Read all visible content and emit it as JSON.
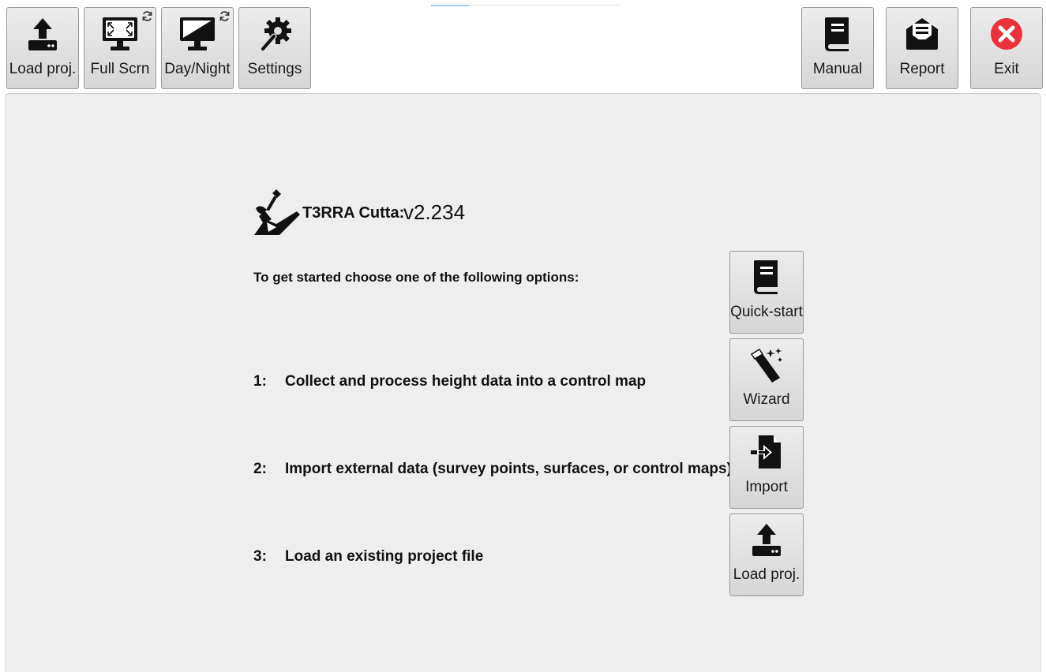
{
  "toolbar": {
    "load_project_label": "Load proj.",
    "full_screen_label": "Full Scrn",
    "day_night_label": "Day/Night",
    "settings_label": "Settings",
    "manual_label": "Manual",
    "report_label": "Report",
    "exit_label": "Exit"
  },
  "app": {
    "name": "T3RRA Cutta:",
    "version": "v2.234"
  },
  "start": {
    "intro": "To get started choose one of the following options:",
    "quickstart_label": "Quick-start",
    "options": [
      {
        "number": "1:",
        "text": "Collect and process height data into a control map",
        "button_label": "Wizard"
      },
      {
        "number": "2:",
        "text": "Import external data (survey points, surfaces, or control maps)",
        "button_label": "Import"
      },
      {
        "number": "3:",
        "text": "Load an existing project file",
        "button_label": "Load proj."
      }
    ]
  },
  "colors": {
    "exit_icon": "#e8323b",
    "icon": "#111111",
    "panel_bg": "#eeeeee"
  }
}
